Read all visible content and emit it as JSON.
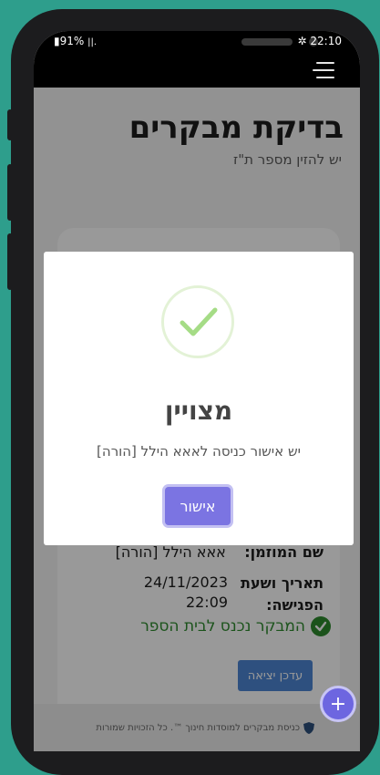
{
  "status": {
    "battery": "91%",
    "signal": "||.",
    "fan_glyph": "✲",
    "time": "22:10"
  },
  "page": {
    "title": "בדיקת מבקרים",
    "subtitle": "יש להזין מספר ת\"ז"
  },
  "details": {
    "inviter_label": "שם המוזמן:",
    "inviter_value": "אאא הילל [הורה]",
    "datetime_label_1": "תאריך ושעת",
    "datetime_label_2": "הפגישה:",
    "date_value": "24/11/2023",
    "time_value": "22:09",
    "entered_text": "המבקר נכנס לבית הספר",
    "update_exit_label": "עדכן יציאה"
  },
  "footer": {
    "text": "כניסת מבקרים למוסדות חינוך ™. כל הזכויות שמורות"
  },
  "fab": {
    "label": "+"
  },
  "modal": {
    "title": "מצויין",
    "message": "יש אישור כניסה לאאא הילל [הורה]",
    "confirm_label": "אישור"
  },
  "colors": {
    "background": "#2e9e8c",
    "accent": "#7b74e2",
    "success": "#2e8b2e",
    "button_blue": "#4e86d4"
  }
}
